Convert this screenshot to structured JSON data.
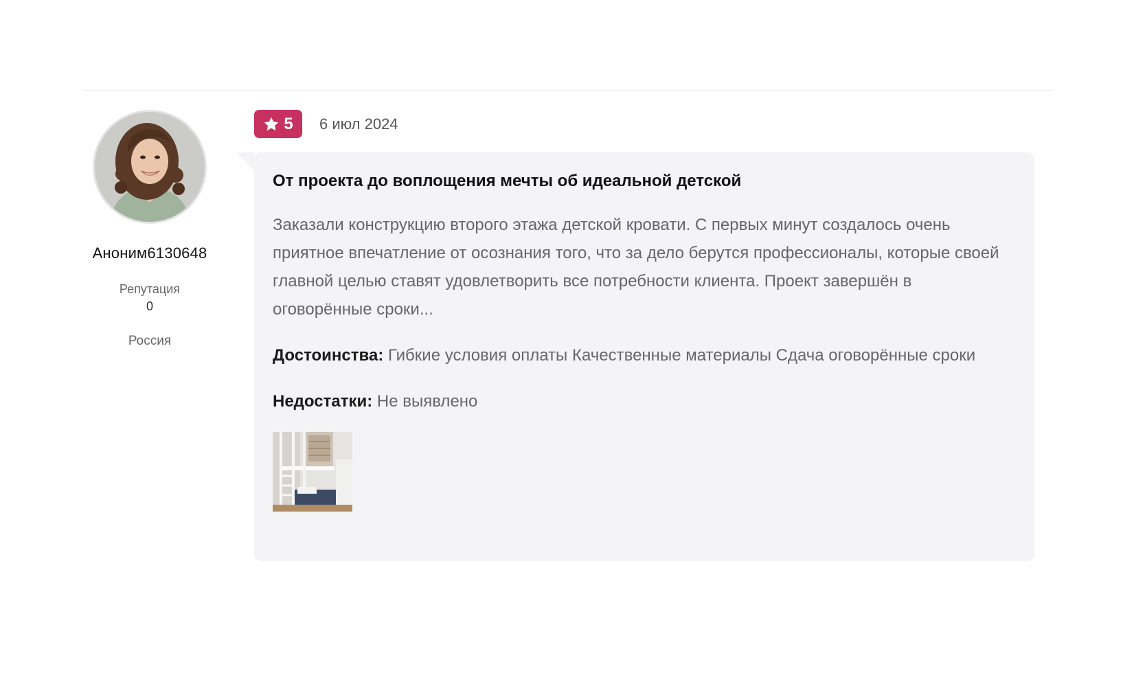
{
  "author": {
    "name": "Аноним6130648",
    "reputation_label": "Репутация",
    "reputation_value": "0",
    "country": "Россия",
    "avatar_icon": "avatar-photo"
  },
  "review": {
    "rating": "5",
    "rating_icon": "star-icon",
    "date": "6 июл 2024",
    "title": "От проекта до воплощения мечты об идеальной детской",
    "text": "Заказали конструкцию второго этажа детской кровати. С первых минут создалось очень приятное впечатление от осознания того, что за дело берутся профессионалы, которые своей главной целью ставят удовлетворить все потребности клиента. Проект завершён в оговорённые сроки...",
    "pros_label": "Достоинства:",
    "pros_text": "Гибкие условия оплаты Качественные материалы Сдача оговорённые сроки",
    "cons_label": "Недостатки:",
    "cons_text": "Не выявлено",
    "photo_icon": "bunk-bed-photo"
  },
  "colors": {
    "accent": "#c73160",
    "card_background": "#f4f4f6",
    "muted_text": "#666666"
  }
}
